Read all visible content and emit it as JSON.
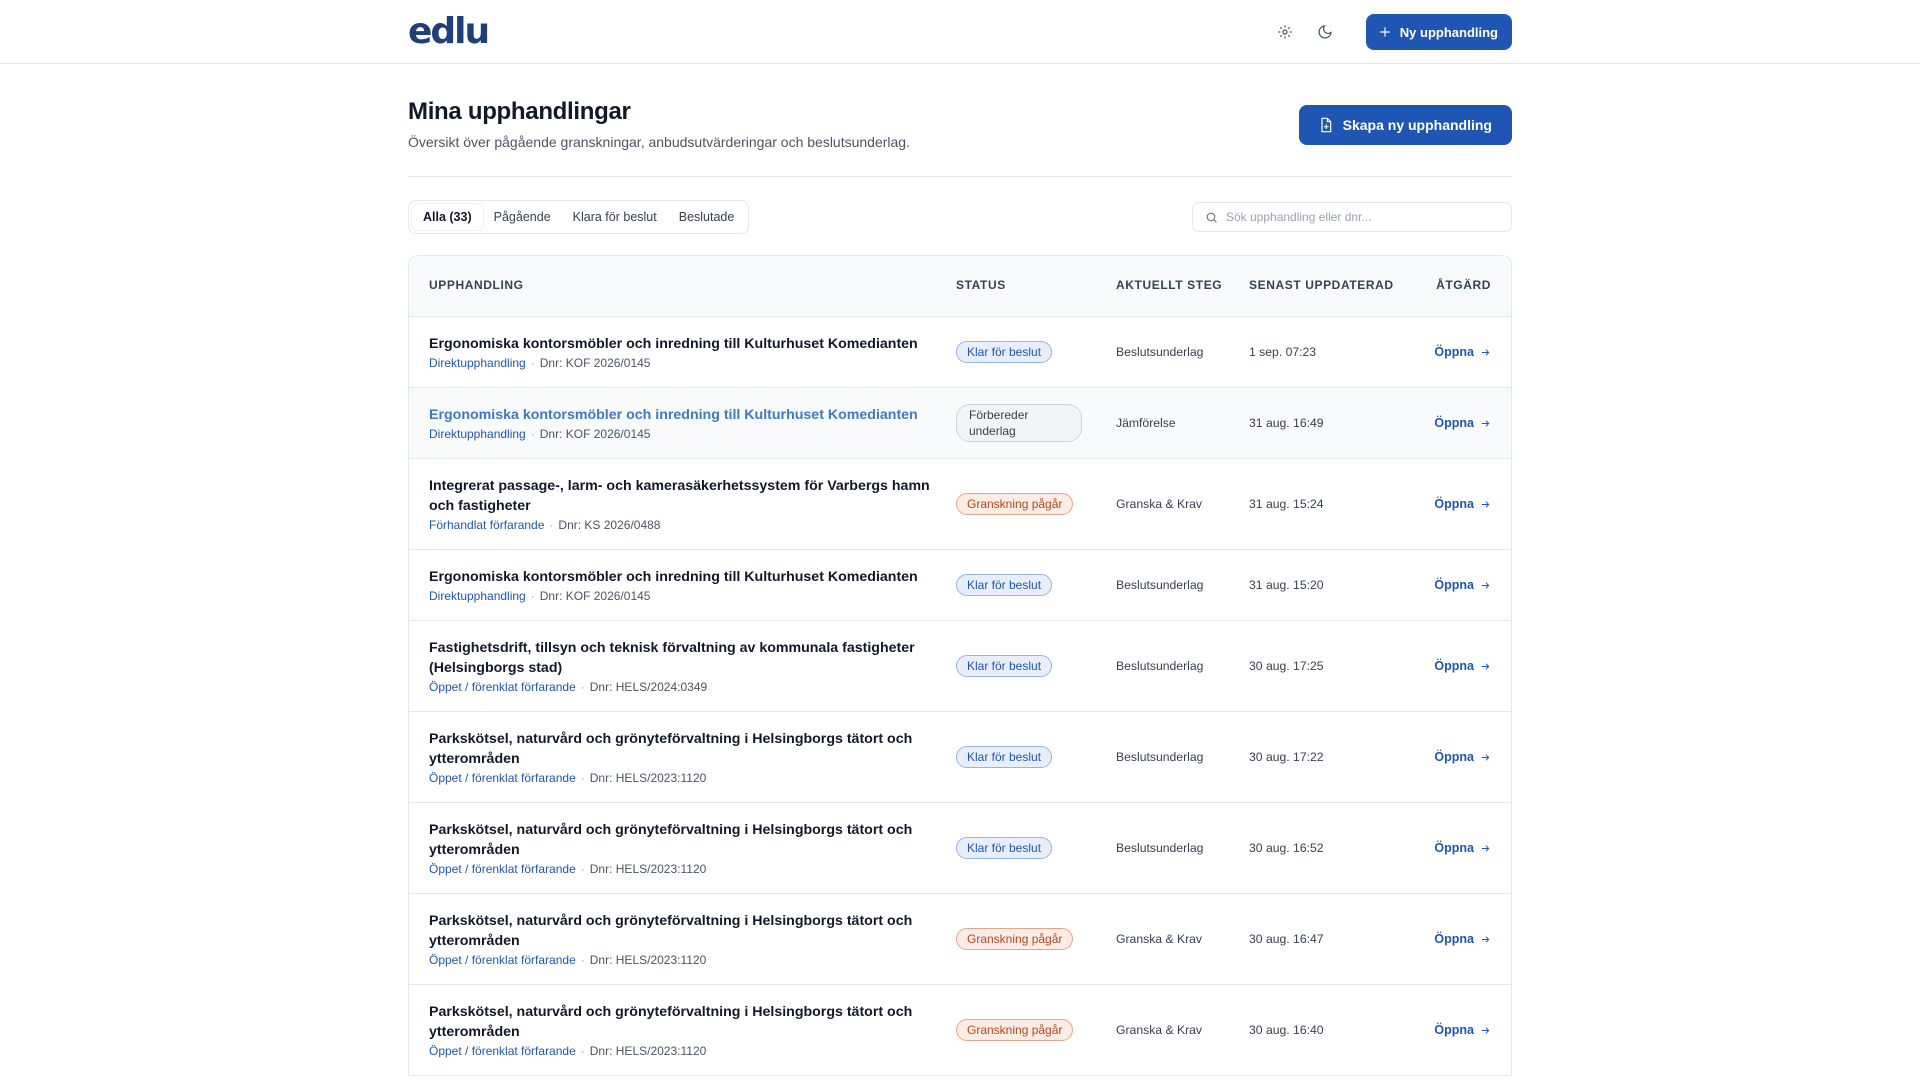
{
  "app": {
    "logo": "edlu",
    "new_button": "Ny upphandling"
  },
  "page": {
    "title": "Mina upphandlingar",
    "subtitle": "Översikt över pågående granskningar, anbudsutvärderingar och beslutsunderlag.",
    "create_button": "Skapa ny upphandling"
  },
  "filters": {
    "tabs": [
      {
        "label": "Alla (33)",
        "active": true
      },
      {
        "label": "Pågående",
        "active": false
      },
      {
        "label": "Klara för beslut",
        "active": false
      },
      {
        "label": "Beslutade",
        "active": false
      }
    ],
    "search_placeholder": "Sök upphandling eller dnr..."
  },
  "table": {
    "headers": {
      "name": "Upphandling",
      "status": "Status",
      "step": "Aktuellt steg",
      "updated": "Senast uppdaterad",
      "action": "Åtgärd"
    },
    "action_label": "Öppna",
    "rows": [
      {
        "title": "Ergonomiska kontorsmöbler och inredning till Kulturhuset Komedianten",
        "type": "Direktupphandling",
        "dnr": "Dnr: KOF 2026/0145",
        "status": "Klar för beslut",
        "status_color": "blue",
        "step": "Beslutsunderlag",
        "updated": "1 sep. 07:23"
      },
      {
        "title": "Ergonomiska kontorsmöbler och inredning till Kulturhuset Komedianten",
        "type": "Direktupphandling",
        "dnr": "Dnr: KOF 2026/0145",
        "status": "Förbereder underlag",
        "status_color": "gray",
        "step": "Jämförelse",
        "updated": "31 aug. 16:49"
      },
      {
        "title": "Integrerat passage-, larm- och kamerasäkerhetssystem för Varbergs hamn och fastigheter",
        "type": "Förhandlat förfarande",
        "dnr": "Dnr: KS 2026/0488",
        "status": "Granskning pågår",
        "status_color": "red",
        "step": "Granska & Krav",
        "updated": "31 aug. 15:24"
      },
      {
        "title": "Ergonomiska kontorsmöbler och inredning till Kulturhuset Komedianten",
        "type": "Direktupphandling",
        "dnr": "Dnr: KOF 2026/0145",
        "status": "Klar för beslut",
        "status_color": "blue",
        "step": "Beslutsunderlag",
        "updated": "31 aug. 15:20"
      },
      {
        "title": "Fastighetsdrift, tillsyn och teknisk förvaltning av kommunala fastigheter (Helsingborgs stad)",
        "type": "Öppet / förenklat förfarande",
        "dnr": "Dnr: HELS/2024:0349",
        "status": "Klar för beslut",
        "status_color": "blue",
        "step": "Beslutsunderlag",
        "updated": "30 aug. 17:25"
      },
      {
        "title": "Parkskötsel, naturvård och grönyteförvaltning i Helsingborgs tätort och ytterområden",
        "type": "Öppet / förenklat förfarande",
        "dnr": "Dnr: HELS/2023:1120",
        "status": "Klar för beslut",
        "status_color": "blue",
        "step": "Beslutsunderlag",
        "updated": "30 aug. 17:22"
      },
      {
        "title": "Parkskötsel, naturvård och grönyteförvaltning i Helsingborgs tätort och ytterområden",
        "type": "Öppet / förenklat förfarande",
        "dnr": "Dnr: HELS/2023:1120",
        "status": "Klar för beslut",
        "status_color": "blue",
        "step": "Beslutsunderlag",
        "updated": "30 aug. 16:52"
      },
      {
        "title": "Parkskötsel, naturvård och grönyteförvaltning i Helsingborgs tätort och ytterområden",
        "type": "Öppet / förenklat förfarande",
        "dnr": "Dnr: HELS/2023:1120",
        "status": "Granskning pågår",
        "status_color": "red",
        "step": "Granska & Krav",
        "updated": "30 aug. 16:47"
      },
      {
        "title": "Parkskötsel, naturvård och grönyteförvaltning i Helsingborgs tätort och ytterområden",
        "type": "Öppet / förenklat förfarande",
        "dnr": "Dnr: HELS/2023:1120",
        "status": "Granskning pågår",
        "status_color": "red",
        "step": "Granska & Krav",
        "updated": "30 aug. 16:40"
      }
    ]
  },
  "colors": {
    "brand": "#1f56b3",
    "logo": "#1f3f7a",
    "status_blue": "#1f56b3",
    "status_red": "#b4471e"
  }
}
